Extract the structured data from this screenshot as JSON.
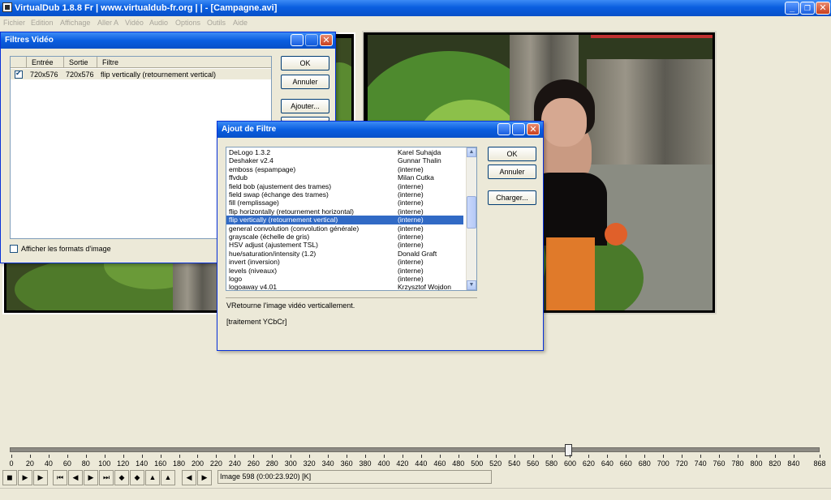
{
  "window": {
    "title": "VirtualDub 1.8.8 Fr | www.virtualdub-fr.org |  |  - [Campagne.avi]",
    "minimize": "_",
    "maximize": "❐",
    "close": "✕"
  },
  "menu": [
    "Fichier",
    "Edition",
    "Affichage",
    "Aller A",
    "Vidéo",
    "Audio",
    "Options",
    "Outils",
    "Aide"
  ],
  "filters_dialog": {
    "title": "Filtres Vidéo",
    "headers": {
      "input": "Entrée",
      "output": "Sortie",
      "filter": "Filtre"
    },
    "rows": [
      {
        "checked": true,
        "input": "720x576",
        "output": "720x576",
        "filter": "flip vertically (retournement vertical)"
      }
    ],
    "ok": "OK",
    "cancel": "Annuler",
    "add": "Ajouter...",
    "show_formats": "Afficher les formats d'image"
  },
  "add_filter_dialog": {
    "title": "Ajout de Filtre",
    "filters": [
      {
        "name": "DeLogo 1.3.2",
        "author": "Karel Suhajda"
      },
      {
        "name": "Deshaker v2.4",
        "author": "Gunnar Thalin"
      },
      {
        "name": "emboss (espampage)",
        "author": "(interne)"
      },
      {
        "name": "ffvdub",
        "author": "Milan Cutka"
      },
      {
        "name": "field bob (ajustement des trames)",
        "author": "(interne)"
      },
      {
        "name": "field swap (échange des trames)",
        "author": "(interne)"
      },
      {
        "name": "fill (remplissage)",
        "author": "(interne)"
      },
      {
        "name": "flip horizontally (retournement horizontal)",
        "author": "(interne)"
      },
      {
        "name": "flip vertically (retournement vertical)",
        "author": "(interne)",
        "selected": true
      },
      {
        "name": "general convolution (convolution générale)",
        "author": "(interne)"
      },
      {
        "name": "grayscale (échelle de gris)",
        "author": "(interne)"
      },
      {
        "name": "HSV adjust (ajustement TSL)",
        "author": "(interne)"
      },
      {
        "name": "hue/saturation/intensity (1.2)",
        "author": "Donald Graft"
      },
      {
        "name": "invert (inversion)",
        "author": "(interne)"
      },
      {
        "name": "levels (niveaux)",
        "author": "(interne)"
      },
      {
        "name": "logo",
        "author": "(interne)"
      },
      {
        "name": "logoaway v4.01",
        "author": "Krzysztof Wojdon"
      }
    ],
    "ok": "OK",
    "cancel": "Annuler",
    "load": "Charger...",
    "description": "VRetourne l'image vidéo verticallement.",
    "description2": "[traitement YCbCr]"
  },
  "timeline": {
    "labels": [
      "0",
      "20",
      "40",
      "60",
      "80",
      "100",
      "120",
      "140",
      "160",
      "180",
      "200",
      "220",
      "240",
      "260",
      "280",
      "300",
      "320",
      "340",
      "360",
      "380",
      "400",
      "420",
      "440",
      "460",
      "480",
      "500",
      "520",
      "540",
      "560",
      "580",
      "600",
      "620",
      "640",
      "660",
      "680",
      "700",
      "720",
      "740",
      "760",
      "780",
      "800",
      "820",
      "840",
      "868"
    ],
    "current_frame": 598,
    "max_frame": 868
  },
  "status": {
    "frame_info": "Image 598 (0:00:23.920) [K]"
  },
  "colors": {
    "title_blue": "#0a5ee0",
    "selection": "#316ac5",
    "face": "#ece9d8"
  }
}
